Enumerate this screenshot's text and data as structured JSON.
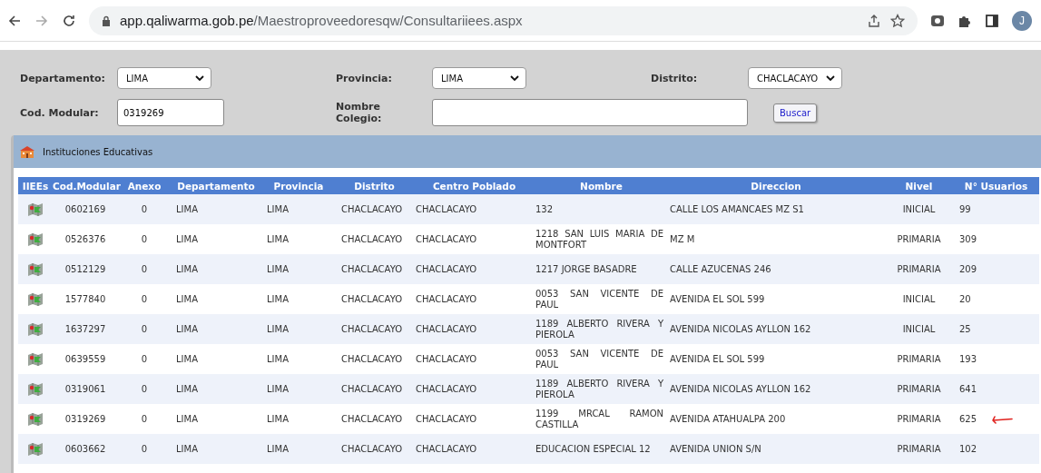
{
  "browser": {
    "url_host": "app.qaliwarma.gob.pe",
    "url_path": "/Maestroproveedoresqw/Consultariiees.aspx",
    "profile_initial": "J"
  },
  "filters": [
    {
      "label": "Departamento:",
      "kind": "select",
      "value": "LIMA"
    },
    {
      "label": "Provincia:",
      "kind": "select",
      "value": "LIMA"
    },
    {
      "label": "Distrito:",
      "kind": "select",
      "value": "CHACLACAYO"
    },
    {
      "label": "Cod. Modular:",
      "kind": "text",
      "value": "0319269"
    },
    {
      "label": "Nombre Colegio:",
      "kind": "text"
    }
  ],
  "search_button": "Buscar",
  "panel": {
    "title": "Instituciones Educativas"
  },
  "table": {
    "columns": [
      "IIEEs",
      "Cod.Modular",
      "Anexo",
      "Departamento",
      "Provincia",
      "Distrito",
      "Centro Poblado",
      "Nombre",
      "Direccion",
      "Nivel",
      "N° Usuarios"
    ],
    "rows": [
      {
        "marked": false,
        "cells": [
          "",
          "0602169",
          "0",
          "LIMA",
          "LIMA",
          "CHACLACAYO",
          "CHACLACAYO",
          "132",
          "CALLE LOS AMANCAES MZ S1",
          "INICIAL",
          "99"
        ]
      },
      {
        "marked": false,
        "cells": [
          "",
          "0526376",
          "0",
          "LIMA",
          "LIMA",
          "CHACLACAYO",
          "CHACLACAYO",
          "1218 SAN LUIS MARIA DE MONTFORT",
          "MZ M",
          "PRIMARIA",
          "309"
        ]
      },
      {
        "marked": false,
        "cells": [
          "",
          "0512129",
          "0",
          "LIMA",
          "LIMA",
          "CHACLACAYO",
          "CHACLACAYO",
          "1217 JORGE BASADRE",
          "CALLE AZUCENAS 246",
          "PRIMARIA",
          "209"
        ]
      },
      {
        "marked": false,
        "cells": [
          "",
          "1577840",
          "0",
          "LIMA",
          "LIMA",
          "CHACLACAYO",
          "CHACLACAYO",
          "0053 SAN VICENTE DE PAUL",
          "AVENIDA EL SOL 599",
          "INICIAL",
          "20"
        ]
      },
      {
        "marked": false,
        "cells": [
          "",
          "1637297",
          "0",
          "LIMA",
          "LIMA",
          "CHACLACAYO",
          "CHACLACAYO",
          "1189 ALBERTO RIVERA Y PIEROLA",
          "AVENIDA NICOLAS AYLLON 162",
          "INICIAL",
          "25"
        ]
      },
      {
        "marked": false,
        "cells": [
          "",
          "0639559",
          "0",
          "LIMA",
          "LIMA",
          "CHACLACAYO",
          "CHACLACAYO",
          "0053 SAN VICENTE DE PAUL",
          "AVENIDA EL SOL 599",
          "PRIMARIA",
          "193"
        ]
      },
      {
        "marked": false,
        "cells": [
          "",
          "0319061",
          "0",
          "LIMA",
          "LIMA",
          "CHACLACAYO",
          "CHACLACAYO",
          "1189 ALBERTO RIVERA Y PIEROLA",
          "AVENIDA NICOLAS AYLLON 162",
          "PRIMARIA",
          "641"
        ]
      },
      {
        "marked": true,
        "cells": [
          "",
          "0319269",
          "0",
          "LIMA",
          "LIMA",
          "CHACLACAYO",
          "CHACLACAYO",
          "1199 MRCAL RAMON CASTILLA",
          "AVENIDA ATAHUALPA 200",
          "PRIMARIA",
          "625"
        ]
      },
      {
        "marked": false,
        "cells": [
          "",
          "0603662",
          "0",
          "LIMA",
          "LIMA",
          "CHACLACAYO",
          "CHACLACAYO",
          "EDUCACION ESPECIAL 12",
          "AVENIDA UNION S/N",
          "PRIMARIA",
          "102"
        ]
      }
    ]
  }
}
